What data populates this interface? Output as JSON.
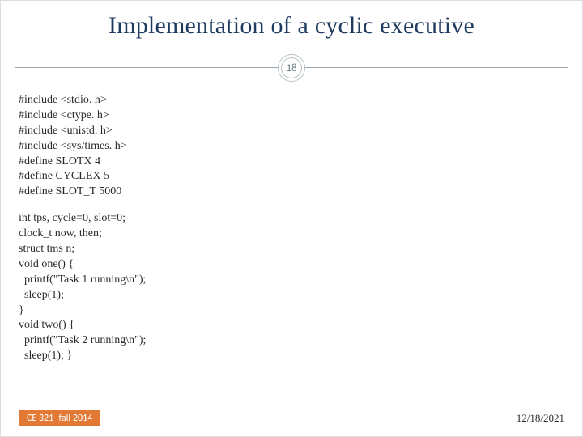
{
  "title": "Implementation of a cyclic executive",
  "page_number": "18",
  "code_block1": "#include <stdio. h>\n#include <ctype. h>\n#include <unistd. h>\n#include <sys/times. h>\n#define SLOTX 4\n#define CYCLEX 5\n#define SLOT_T 5000",
  "code_block2": "int tps, cycle=0, slot=0;\nclock_t now, then;\nstruct tms n;\nvoid one() {\n  printf(\"Task 1 running\\n\");\n  sleep(1);\n}\nvoid two() {\n  printf(\"Task 2 running\\n\");\n  sleep(1); }",
  "footer_left": "CE 321 -fall 2014",
  "footer_right": "12/18/2021"
}
